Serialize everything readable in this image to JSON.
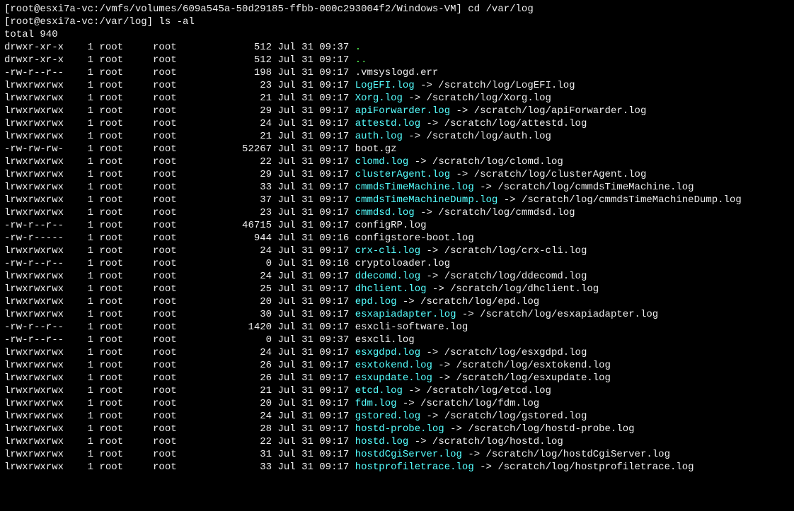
{
  "prompt1": {
    "user": "root",
    "host": "esxi7a-vc",
    "cwd": "/vmfs/volumes/609a545a-50d29185-ffbb-000c293004f2/Windows-VM",
    "cmd": "cd /var/log"
  },
  "prompt2": {
    "user": "root",
    "host": "esxi7a-vc",
    "cwd": "/var/log",
    "cmd": "ls -al"
  },
  "total": "total 940",
  "rows": [
    {
      "perm": "drwxr-xr-x",
      "n": "1",
      "u": "root",
      "g": "root",
      "sz": "512",
      "d": "Jul 31 09:37",
      "name": ".",
      "cls": "g"
    },
    {
      "perm": "drwxr-xr-x",
      "n": "1",
      "u": "root",
      "g": "root",
      "sz": "512",
      "d": "Jul 31 09:17",
      "name": "..",
      "cls": "g"
    },
    {
      "perm": "-rw-r--r--",
      "n": "1",
      "u": "root",
      "g": "root",
      "sz": "198",
      "d": "Jul 31 09:17",
      "name": ".vmsyslogd.err",
      "cls": "w"
    },
    {
      "perm": "lrwxrwxrwx",
      "n": "1",
      "u": "root",
      "g": "root",
      "sz": "23",
      "d": "Jul 31 09:17",
      "name": "LogEFI.log",
      "cls": "c",
      "to": "/scratch/log/LogEFI.log"
    },
    {
      "perm": "lrwxrwxrwx",
      "n": "1",
      "u": "root",
      "g": "root",
      "sz": "21",
      "d": "Jul 31 09:17",
      "name": "Xorg.log",
      "cls": "c",
      "to": "/scratch/log/Xorg.log"
    },
    {
      "perm": "lrwxrwxrwx",
      "n": "1",
      "u": "root",
      "g": "root",
      "sz": "29",
      "d": "Jul 31 09:17",
      "name": "apiForwarder.log",
      "cls": "c",
      "to": "/scratch/log/apiForwarder.log"
    },
    {
      "perm": "lrwxrwxrwx",
      "n": "1",
      "u": "root",
      "g": "root",
      "sz": "24",
      "d": "Jul 31 09:17",
      "name": "attestd.log",
      "cls": "c",
      "to": "/scratch/log/attestd.log"
    },
    {
      "perm": "lrwxrwxrwx",
      "n": "1",
      "u": "root",
      "g": "root",
      "sz": "21",
      "d": "Jul 31 09:17",
      "name": "auth.log",
      "cls": "c",
      "to": "/scratch/log/auth.log"
    },
    {
      "perm": "-rw-rw-rw-",
      "n": "1",
      "u": "root",
      "g": "root",
      "sz": "52267",
      "d": "Jul 31 09:17",
      "name": "boot.gz",
      "cls": "w"
    },
    {
      "perm": "lrwxrwxrwx",
      "n": "1",
      "u": "root",
      "g": "root",
      "sz": "22",
      "d": "Jul 31 09:17",
      "name": "clomd.log",
      "cls": "c",
      "to": "/scratch/log/clomd.log"
    },
    {
      "perm": "lrwxrwxrwx",
      "n": "1",
      "u": "root",
      "g": "root",
      "sz": "29",
      "d": "Jul 31 09:17",
      "name": "clusterAgent.log",
      "cls": "c",
      "to": "/scratch/log/clusterAgent.log"
    },
    {
      "perm": "lrwxrwxrwx",
      "n": "1",
      "u": "root",
      "g": "root",
      "sz": "33",
      "d": "Jul 31 09:17",
      "name": "cmmdsTimeMachine.log",
      "cls": "c",
      "to": "/scratch/log/cmmdsTimeMachine.log",
      "wrap": "og"
    },
    {
      "perm": "lrwxrwxrwx",
      "n": "1",
      "u": "root",
      "g": "root",
      "sz": "37",
      "d": "Jul 31 09:17",
      "name": "cmmdsTimeMachineDump.log",
      "cls": "c",
      "to": "/scratch/log/cmmdsTimeMachineDump.log",
      "wrap": "neDump.log"
    },
    {
      "perm": "lrwxrwxrwx",
      "n": "1",
      "u": "root",
      "g": "root",
      "sz": "23",
      "d": "Jul 31 09:17",
      "name": "cmmdsd.log",
      "cls": "c",
      "to": "/scratch/log/cmmdsd.log"
    },
    {
      "perm": "-rw-r--r--",
      "n": "1",
      "u": "root",
      "g": "root",
      "sz": "46715",
      "d": "Jul 31 09:17",
      "name": "configRP.log",
      "cls": "w"
    },
    {
      "perm": "-rw-r-----",
      "n": "1",
      "u": "root",
      "g": "root",
      "sz": "944",
      "d": "Jul 31 09:16",
      "name": "configstore-boot.log",
      "cls": "w"
    },
    {
      "perm": "lrwxrwxrwx",
      "n": "1",
      "u": "root",
      "g": "root",
      "sz": "24",
      "d": "Jul 31 09:17",
      "name": "crx-cli.log",
      "cls": "c",
      "to": "/scratch/log/crx-cli.log"
    },
    {
      "perm": "-rw-r--r--",
      "n": "1",
      "u": "root",
      "g": "root",
      "sz": "0",
      "d": "Jul 31 09:16",
      "name": "cryptoloader.log",
      "cls": "w"
    },
    {
      "perm": "lrwxrwxrwx",
      "n": "1",
      "u": "root",
      "g": "root",
      "sz": "24",
      "d": "Jul 31 09:17",
      "name": "ddecomd.log",
      "cls": "c",
      "to": "/scratch/log/ddecomd.log"
    },
    {
      "perm": "lrwxrwxrwx",
      "n": "1",
      "u": "root",
      "g": "root",
      "sz": "25",
      "d": "Jul 31 09:17",
      "name": "dhclient.log",
      "cls": "c",
      "to": "/scratch/log/dhclient.log"
    },
    {
      "perm": "lrwxrwxrwx",
      "n": "1",
      "u": "root",
      "g": "root",
      "sz": "20",
      "d": "Jul 31 09:17",
      "name": "epd.log",
      "cls": "c",
      "to": "/scratch/log/epd.log"
    },
    {
      "perm": "lrwxrwxrwx",
      "n": "1",
      "u": "root",
      "g": "root",
      "sz": "30",
      "d": "Jul 31 09:17",
      "name": "esxapiadapter.log",
      "cls": "c",
      "to": "/scratch/log/esxapiadapter.log"
    },
    {
      "perm": "-rw-r--r--",
      "n": "1",
      "u": "root",
      "g": "root",
      "sz": "1420",
      "d": "Jul 31 09:17",
      "name": "esxcli-software.log",
      "cls": "w"
    },
    {
      "perm": "-rw-r--r--",
      "n": "1",
      "u": "root",
      "g": "root",
      "sz": "0",
      "d": "Jul 31 09:37",
      "name": "esxcli.log",
      "cls": "w"
    },
    {
      "perm": "lrwxrwxrwx",
      "n": "1",
      "u": "root",
      "g": "root",
      "sz": "24",
      "d": "Jul 31 09:17",
      "name": "esxgdpd.log",
      "cls": "c",
      "to": "/scratch/log/esxgdpd.log"
    },
    {
      "perm": "lrwxrwxrwx",
      "n": "1",
      "u": "root",
      "g": "root",
      "sz": "26",
      "d": "Jul 31 09:17",
      "name": "esxtokend.log",
      "cls": "c",
      "to": "/scratch/log/esxtokend.log"
    },
    {
      "perm": "lrwxrwxrwx",
      "n": "1",
      "u": "root",
      "g": "root",
      "sz": "26",
      "d": "Jul 31 09:17",
      "name": "esxupdate.log",
      "cls": "c",
      "to": "/scratch/log/esxupdate.log"
    },
    {
      "perm": "lrwxrwxrwx",
      "n": "1",
      "u": "root",
      "g": "root",
      "sz": "21",
      "d": "Jul 31 09:17",
      "name": "etcd.log",
      "cls": "c",
      "to": "/scratch/log/etcd.log"
    },
    {
      "perm": "lrwxrwxrwx",
      "n": "1",
      "u": "root",
      "g": "root",
      "sz": "20",
      "d": "Jul 31 09:17",
      "name": "fdm.log",
      "cls": "c",
      "to": "/scratch/log/fdm.log"
    },
    {
      "perm": "lrwxrwxrwx",
      "n": "1",
      "u": "root",
      "g": "root",
      "sz": "24",
      "d": "Jul 31 09:17",
      "name": "gstored.log",
      "cls": "c",
      "to": "/scratch/log/gstored.log"
    },
    {
      "perm": "lrwxrwxrwx",
      "n": "1",
      "u": "root",
      "g": "root",
      "sz": "28",
      "d": "Jul 31 09:17",
      "name": "hostd-probe.log",
      "cls": "c",
      "to": "/scratch/log/hostd-probe.log"
    },
    {
      "perm": "lrwxrwxrwx",
      "n": "1",
      "u": "root",
      "g": "root",
      "sz": "22",
      "d": "Jul 31 09:17",
      "name": "hostd.log",
      "cls": "c",
      "to": "/scratch/log/hostd.log"
    },
    {
      "perm": "lrwxrwxrwx",
      "n": "1",
      "u": "root",
      "g": "root",
      "sz": "31",
      "d": "Jul 31 09:17",
      "name": "hostdCgiServer.log",
      "cls": "c",
      "to": "/scratch/log/hostdCgiServer.log"
    },
    {
      "perm": "lrwxrwxrwx",
      "n": "1",
      "u": "root",
      "g": "root",
      "sz": "33",
      "d": "Jul 31 09:17",
      "name": "hostprofiletrace.log",
      "cls": "c",
      "to": "/scratch/log/hostprofiletrace.log",
      "wrap": "og"
    }
  ]
}
